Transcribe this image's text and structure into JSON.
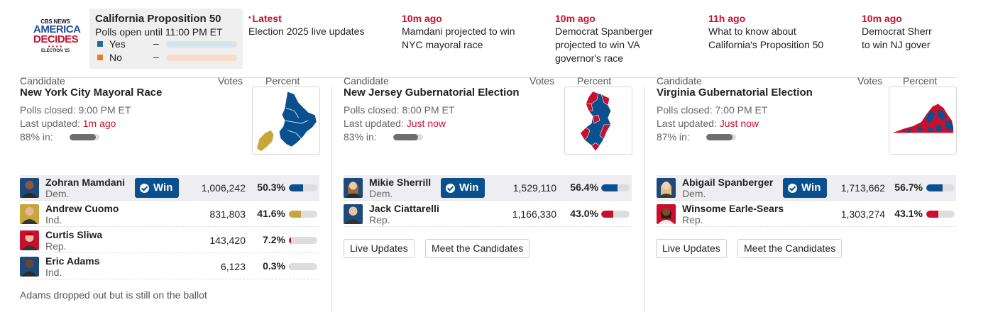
{
  "logo": {
    "line1": "CBS NEWS",
    "line2": "AMERICA",
    "line3": "DECIDES",
    "stars": "★★★★",
    "line4": "ELECTION '25"
  },
  "proposition": {
    "title": "California Proposition 50",
    "status": "Polls open until 11:00 PM ET",
    "options": [
      {
        "label": "Yes",
        "dash": "–",
        "color": "#1a6fa0",
        "track_color": "#d5e3eb"
      },
      {
        "label": "No",
        "dash": "–",
        "color": "#f07c22",
        "track_color": "#f8dcc8"
      }
    ]
  },
  "news": [
    {
      "time": "Latest",
      "headline": "Election 2025 live updates",
      "dot": "•"
    },
    {
      "time": "10m ago",
      "headline": "Mamdani projected to win NYC mayoral race"
    },
    {
      "time": "10m ago",
      "headline": "Democrat Spanberger projected to win VA governor's race"
    },
    {
      "time": "11h ago",
      "headline": "What to know about California's Proposition 50"
    },
    {
      "time": "10m ago",
      "headline": "Democrat Sherr to win NJ gover"
    }
  ],
  "columns": {
    "candidate": "Candidate",
    "votes": "Votes",
    "percent": "Percent"
  },
  "win_label": "Win",
  "colors": {
    "dem": "#0a4f8e",
    "rep": "#c8102e",
    "ind": "#c9a63c",
    "accent_red": "#c8102e"
  },
  "races": [
    {
      "title": "New York City Mayoral Race",
      "polls": "Polls closed: 9:00 PM ET",
      "updated_prefix": "Last updated: ",
      "updated": "1m ago",
      "reporting": "88% in:",
      "reporting_fraction": 0.88,
      "map_icon": "nyc-boroughs-map",
      "candidates": [
        {
          "name": "Zohran Mamdani",
          "party": "Dem.",
          "votes": "1,006,242",
          "percent": "50.3%",
          "pct_value": 50.3,
          "winner": true,
          "bar_color": "#0a4f8e"
        },
        {
          "name": "Andrew Cuomo",
          "party": "Ind.",
          "votes": "831,803",
          "percent": "41.6%",
          "pct_value": 41.6,
          "winner": false,
          "bar_color": "#c9a63c"
        },
        {
          "name": "Curtis Sliwa",
          "party": "Rep.",
          "votes": "143,420",
          "percent": "7.2%",
          "pct_value": 7.2,
          "winner": false,
          "bar_color": "#c8102e"
        },
        {
          "name": "Eric Adams",
          "party": "Ind.",
          "votes": "6,123",
          "percent": "0.3%",
          "pct_value": 0.3,
          "winner": false,
          "bar_color": "#c9a63c"
        }
      ],
      "note": "Adams dropped out but is still on the ballot"
    },
    {
      "title": "New Jersey Gubernatorial Election",
      "polls": "Polls closed: 8:00 PM ET",
      "updated_prefix": "Last updated: ",
      "updated": "Just now",
      "reporting": "83% in:",
      "reporting_fraction": 0.83,
      "map_icon": "new-jersey-county-map",
      "candidates": [
        {
          "name": "Mikie Sherrill",
          "party": "Dem.",
          "votes": "1,529,110",
          "percent": "56.4%",
          "pct_value": 56.4,
          "winner": true,
          "bar_color": "#0a4f8e"
        },
        {
          "name": "Jack Ciattarelli",
          "party": "Rep.",
          "votes": "1,166,330",
          "percent": "43.0%",
          "pct_value": 43.0,
          "winner": false,
          "bar_color": "#c8102e"
        }
      ],
      "buttons": [
        "Live Updates",
        "Meet the Candidates"
      ]
    },
    {
      "title": "Virginia Gubernatorial Election",
      "polls": "Polls closed: 7:00 PM ET",
      "updated_prefix": "Last updated: ",
      "updated": "Just now",
      "reporting": "87% in:",
      "reporting_fraction": 0.87,
      "map_icon": "virginia-county-map",
      "candidates": [
        {
          "name": "Abigail Spanberger",
          "party": "Dem.",
          "votes": "1,713,662",
          "percent": "56.7%",
          "pct_value": 56.7,
          "winner": true,
          "bar_color": "#0a4f8e"
        },
        {
          "name": "Winsome Earle-Sears",
          "party": "Rep.",
          "votes": "1,303,274",
          "percent": "43.1%",
          "pct_value": 43.1,
          "winner": false,
          "bar_color": "#c8102e"
        }
      ],
      "buttons": [
        "Live Updates",
        "Meet the Candidates"
      ]
    }
  ]
}
